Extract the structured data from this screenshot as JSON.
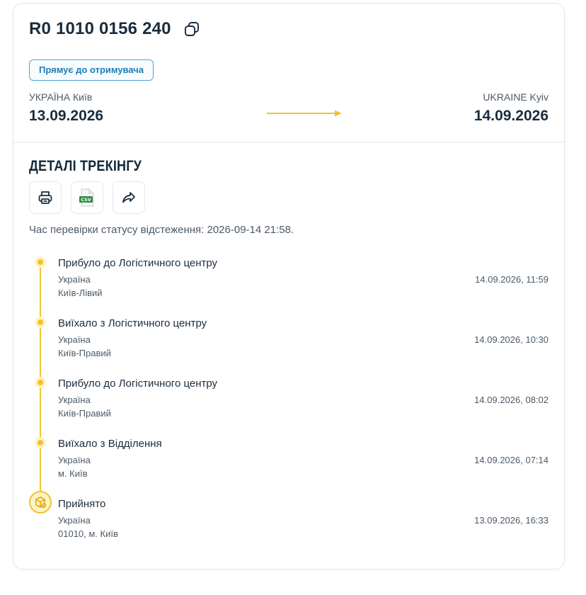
{
  "shipment": {
    "tracking_number": "R0 1010 0156 240",
    "delivery_type": "Прямує до отримувача"
  },
  "route": {
    "from_city": "УКРАЇНА Київ",
    "from_date": "13.09.2026",
    "to_city": "UKRAINE Kyiv",
    "to_date": "14.09.2026"
  },
  "tracking": {
    "title": "ДЕТАЛІ ТРЕКІНГУ",
    "csv_label": "CSV",
    "check_time": "Час перевірки статусу відстеження: 2026-09-14 21:58.",
    "events": [
      {
        "title": "Прибуло до Логістичного центру",
        "country": "Україна",
        "place": "Київ-Лівий",
        "time": "14.09.2026, 11:59"
      },
      {
        "title": "Виїхало з Логістичного центру",
        "country": "Україна",
        "place": "Київ-Правий",
        "time": "14.09.2026, 10:30"
      },
      {
        "title": "Прибуло до Логістичного центру",
        "country": "Україна",
        "place": "Київ-Правий",
        "time": "14.09.2026, 08:02"
      },
      {
        "title": "Виїхало з Відділення",
        "country": "Україна",
        "place": "м. Київ",
        "time": "14.09.2026, 07:14"
      },
      {
        "title": "Прийнято",
        "country": "Україна",
        "place": "01010, м. Київ",
        "time": "13.09.2026, 16:33"
      }
    ]
  },
  "colors": {
    "accent_yellow": "#f2c230",
    "badge_blue": "#1c7fb8",
    "csv_green": "#2e8b3e",
    "text_dark": "#1a2c3d"
  },
  "icons": {
    "copy": "copy-icon",
    "print": "printer-icon",
    "csv": "csv-file-icon",
    "share": "share-icon",
    "accepted": "package-icon"
  }
}
